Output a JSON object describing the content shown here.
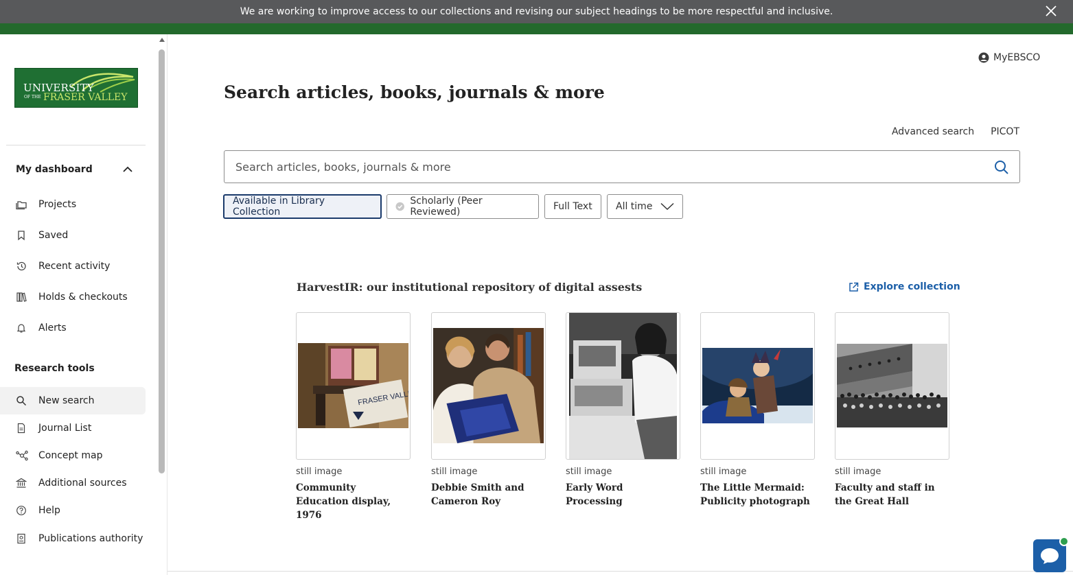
{
  "banner": {
    "message": "We are working to improve access to our collections and revising our subject headings to be more respectful and inclusive."
  },
  "logo": {
    "line1": "UNIVERSITY",
    "of_the": "OF THE",
    "line2": "FRASER VALLEY"
  },
  "sidebar": {
    "dashboard_label": "My dashboard",
    "dashboard_items": [
      {
        "label": "Projects",
        "icon": "folder-icon"
      },
      {
        "label": "Saved",
        "icon": "bookmark-icon"
      },
      {
        "label": "Recent activity",
        "icon": "history-icon"
      },
      {
        "label": "Holds & checkouts",
        "icon": "books-icon"
      },
      {
        "label": "Alerts",
        "icon": "bell-icon"
      }
    ],
    "research_label": "Research tools",
    "research_items": [
      {
        "label": "New search",
        "icon": "search-icon"
      },
      {
        "label": "Journal List",
        "icon": "document-icon"
      },
      {
        "label": "Concept map",
        "icon": "concept-map-icon"
      },
      {
        "label": "Additional sources",
        "icon": "institution-icon"
      },
      {
        "label": "Help",
        "icon": "help-icon"
      },
      {
        "label": "Publications authority",
        "icon": "publication-icon"
      }
    ]
  },
  "header": {
    "account_label": "MyEBSCO"
  },
  "main": {
    "title": "Search articles, books, journals & more",
    "advanced_search": "Advanced search",
    "picot": "PICOT",
    "search_placeholder": "Search articles, books, journals & more",
    "filters": [
      {
        "label": "Available in Library Collection",
        "selected": true
      },
      {
        "label": "Scholarly (Peer Reviewed)",
        "selected": false
      },
      {
        "label": "Full Text",
        "selected": false
      },
      {
        "label": "All time",
        "selected": false
      }
    ]
  },
  "collection": {
    "title": "HarvestIR: our institutional repository of digital assests",
    "explore_label": "Explore collection",
    "items": [
      {
        "type": "still image",
        "title": "Community Education display, 1976"
      },
      {
        "type": "still image",
        "title": "Debbie Smith and Cameron Roy"
      },
      {
        "type": "still image",
        "title": "Early Word Processing"
      },
      {
        "type": "still image",
        "title": "The Little Mermaid: Publicity photograph"
      },
      {
        "type": "still image",
        "title": "Faculty and staff in the Great Hall"
      }
    ]
  },
  "colors": {
    "banner": "#58595b",
    "green_bar": "#23692c",
    "link": "#1c5fa8",
    "selected_filter_border": "#1a3a6b"
  }
}
